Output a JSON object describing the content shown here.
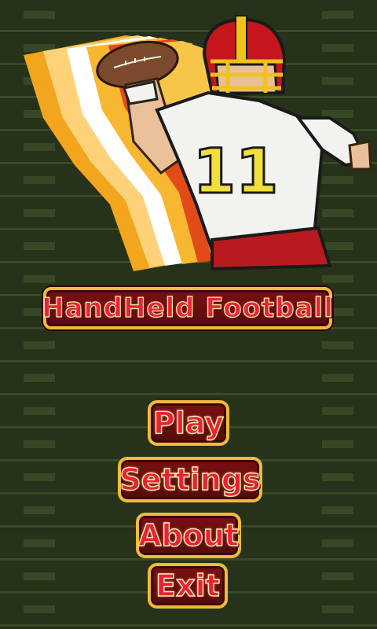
{
  "game": {
    "title": "HandHeld Football",
    "hero_jersey_number": "11"
  },
  "menu": {
    "play": "Play",
    "settings": "Settings",
    "about": "About",
    "exit": "Exit"
  },
  "colors": {
    "field": "#26331a",
    "button_fill": "#7a1012",
    "button_border": "#f4b93a",
    "label_red": "#e8233b",
    "jersey_white": "#f2f2ee",
    "jersey_number": "#f3df3a",
    "helmet_red": "#c4161c",
    "helmet_gold": "#f0c21e"
  },
  "icons": {
    "hero": "quarterback-throwing-football",
    "ball": "football-icon"
  }
}
